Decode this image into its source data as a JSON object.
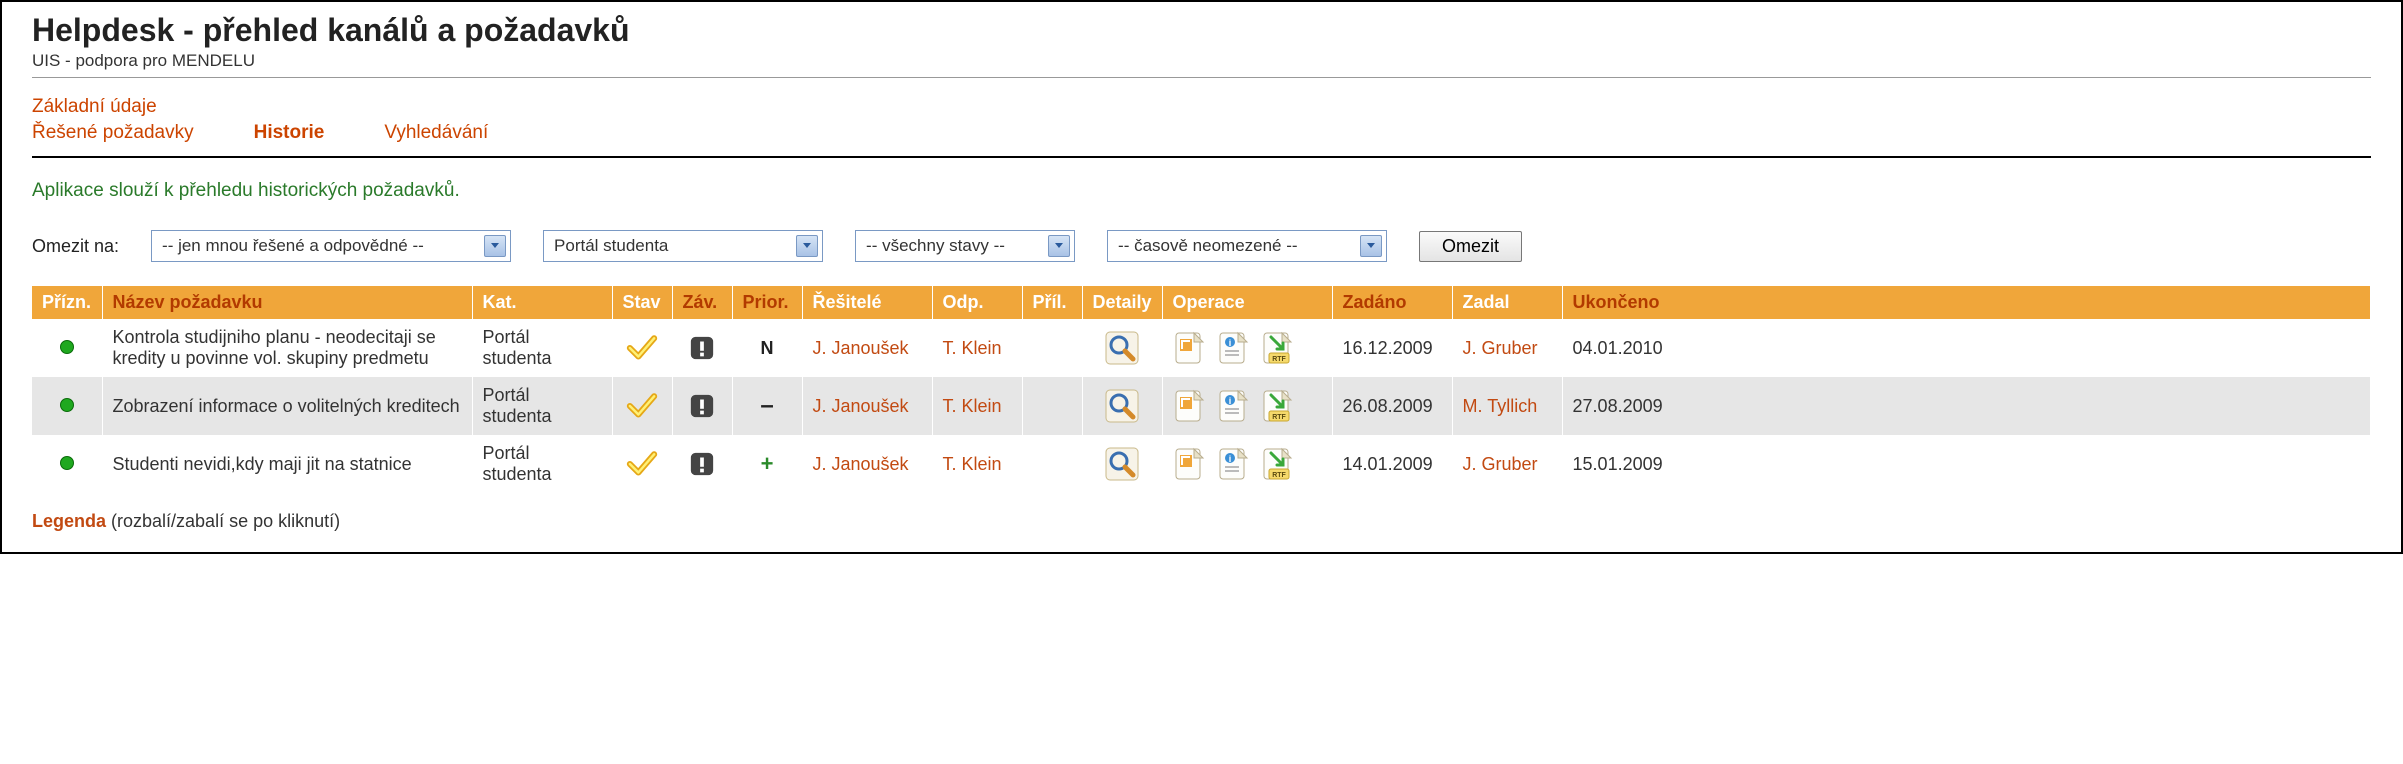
{
  "header": {
    "title": "Helpdesk - přehled kanálů a požadavků",
    "subtitle": "UIS - podpora pro MENDELU"
  },
  "nav": {
    "row1": [
      {
        "label": "Základní údaje"
      }
    ],
    "row2": [
      {
        "label": "Řešené požadavky"
      },
      {
        "label": "Historie",
        "active": true
      },
      {
        "label": "Vyhledávání"
      }
    ]
  },
  "description": "Aplikace slouží k přehledu historických požadavků.",
  "filters": {
    "label": "Omezit na:",
    "sel1": "-- jen mnou řešené a odpovědné --",
    "sel2": "Portál studenta",
    "sel3": "-- všechny stavy --",
    "sel4": "-- časově neomezené --",
    "submit": "Omezit"
  },
  "table": {
    "headers": {
      "prizn": "Přízn.",
      "nazev": "Název požadavku",
      "kat": "Kat.",
      "stav": "Stav",
      "zav": "Záv.",
      "prior": "Prior.",
      "resitele": "Řešitelé",
      "odp": "Odp.",
      "pril": "Příl.",
      "detaily": "Detaily",
      "operace": "Operace",
      "zadano": "Zadáno",
      "zadal": "Zadal",
      "ukonceno": "Ukončeno"
    },
    "rows": [
      {
        "nazev": "Kontrola studijniho planu - neodecitaji se kredity u povinne vol. skupiny predmetu",
        "kat": "Portál studenta",
        "prior": "N",
        "resitele": "J. Janoušek",
        "odp": "T. Klein",
        "zadano": "16.12.2009",
        "zadal": "J. Gruber",
        "ukonceno": "04.01.2010"
      },
      {
        "nazev": "Zobrazení informace o volitelných kreditech",
        "kat": "Portál studenta",
        "prior": "-",
        "resitele": "J. Janoušek",
        "odp": "T. Klein",
        "zadano": "26.08.2009",
        "zadal": "M. Tyllich",
        "ukonceno": "27.08.2009"
      },
      {
        "nazev": "Studenti nevidi,kdy maji jit na statnice",
        "kat": "Portál studenta",
        "prior": "+",
        "resitele": "J. Janoušek",
        "odp": "T. Klein",
        "zadano": "14.01.2009",
        "zadal": "J. Gruber",
        "ukonceno": "15.01.2009"
      }
    ]
  },
  "legend": {
    "label": "Legenda",
    "hint": " (rozbalí/zabalí se po kliknutí)"
  },
  "icons": {
    "check": "check-icon",
    "severity": "severity-icon",
    "magnify": "magnify-icon",
    "op1": "op-history-icon",
    "op2": "op-detail-icon",
    "op3": "op-rtf-icon"
  }
}
